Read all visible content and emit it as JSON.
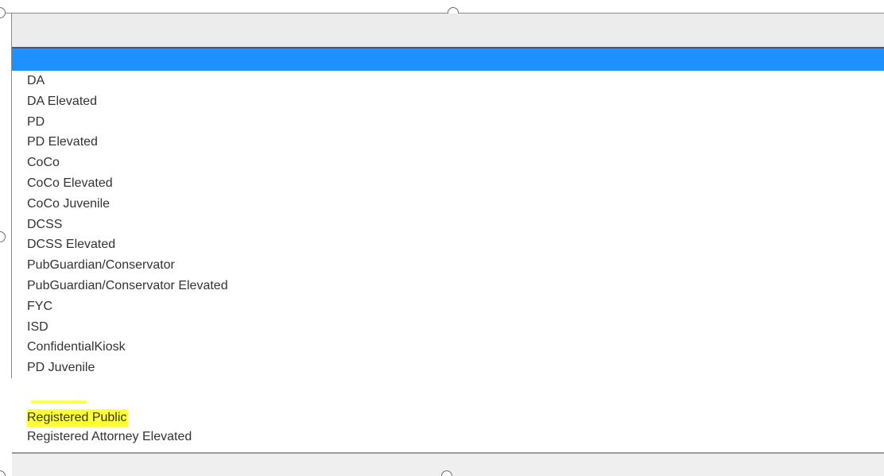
{
  "select": {
    "current_value": ""
  },
  "dropdown": {
    "highlighted_option": "",
    "options": [
      "DA",
      "DA Elevated",
      "PD",
      "PD Elevated",
      "CoCo",
      "CoCo Elevated",
      "CoCo Juvenile",
      "DCSS",
      "DCSS Elevated",
      "PubGuardian/Conservator",
      "PubGuardian/Conservator Elevated",
      "FYC",
      "ISD",
      "ConfidentialKiosk",
      "PD Juvenile"
    ],
    "cut_off_option": "",
    "bottom_options": [
      "Registered Public",
      "Registered Attorney Elevated"
    ]
  },
  "colors": {
    "highlight_blue": "#1e90ff",
    "highlight_yellow": "#ffff33",
    "select_bg": "#ececec"
  }
}
